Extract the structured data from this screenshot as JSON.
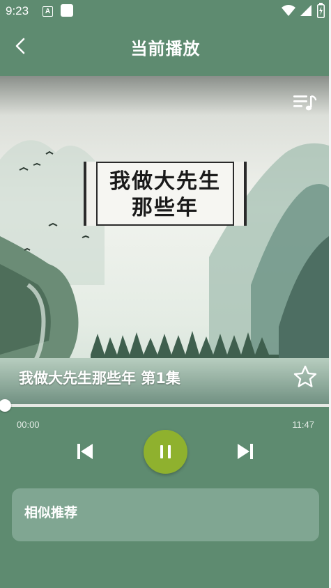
{
  "status_bar": {
    "time": "9:23",
    "a_icon_text": "A",
    "icons": [
      "notification-a-icon",
      "notification-square-icon",
      "wifi-icon",
      "signal-icon",
      "battery-icon"
    ]
  },
  "header": {
    "title": "当前播放",
    "back_icon": "chevron-left-icon"
  },
  "artwork": {
    "sign_text_line1": "我做大先生",
    "sign_text_line2": "那些年",
    "playlist_icon": "playlist-icon"
  },
  "track": {
    "title": "我做大先生那些年 第1集",
    "favorite_icon": "star-outline-icon",
    "is_favorite": false
  },
  "playback": {
    "current_time": "00:00",
    "total_time": "11:47",
    "progress_fraction": 0,
    "state": "playing",
    "prev_icon": "skip-previous-icon",
    "play_pause_icon": "pause-icon",
    "next_icon": "skip-next-icon"
  },
  "similar": {
    "title": "相似推荐"
  },
  "colors": {
    "background": "#5e8b70",
    "accent_button": "#8fb12e",
    "card": "#80a692"
  }
}
